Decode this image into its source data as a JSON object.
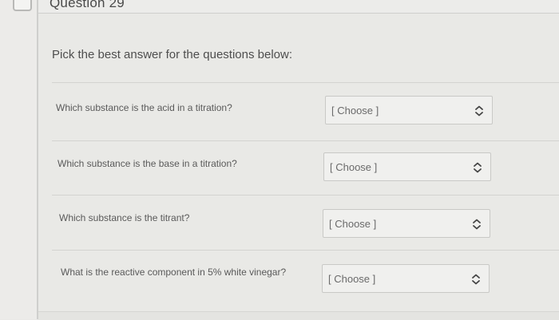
{
  "question": {
    "title": "Question 29"
  },
  "instructions": "Pick the best answer for the questions below:",
  "items": [
    {
      "prompt": "Which substance is the acid in a titration?",
      "selected": "[ Choose ]"
    },
    {
      "prompt": "Which substance is the base in a titration?",
      "selected": "[ Choose ]"
    },
    {
      "prompt": "Which substance is the titrant?",
      "selected": "[ Choose ]"
    },
    {
      "prompt": "What is the reactive component in 5% white vinegar?",
      "selected": "[ Choose ]"
    }
  ],
  "icons": {
    "flag": "flag-icon",
    "dropdown_chevron": "chevron-up-down-icon"
  },
  "colors": {
    "background": "#e9e9e6",
    "text": "#555555",
    "border": "#c9c9c6"
  }
}
